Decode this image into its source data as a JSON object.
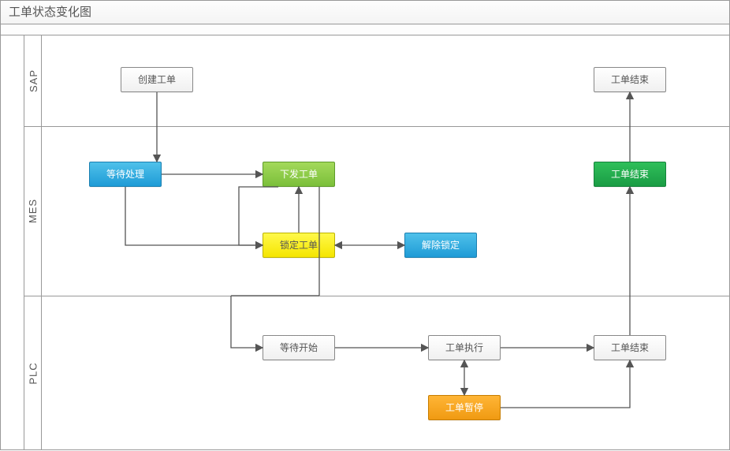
{
  "title": "工单状态变化图",
  "lanes": {
    "sap": "SAP",
    "mes": "MES",
    "plc": "PLC"
  },
  "nodes": {
    "create": "创建工单",
    "end_sap": "工单结束",
    "wait_process": "等待处理",
    "dispatch": "下发工单",
    "lock": "锁定工单",
    "unlock": "解除锁定",
    "end_mes": "工单结束",
    "wait_start": "等待开始",
    "executing": "工单执行",
    "pause": "工单暂停",
    "end_plc": "工单结束"
  },
  "chart_data": {
    "type": "other",
    "diagram_type": "swimlane-flowchart",
    "title": "工单状态变化图",
    "lanes": [
      "SAP",
      "MES",
      "PLC"
    ],
    "nodes": [
      {
        "id": "create",
        "lane": "SAP",
        "label": "创建工单",
        "color": "white"
      },
      {
        "id": "end_sap",
        "lane": "SAP",
        "label": "工单结束",
        "color": "white"
      },
      {
        "id": "wait_process",
        "lane": "MES",
        "label": "等待处理",
        "color": "blue"
      },
      {
        "id": "dispatch",
        "lane": "MES",
        "label": "下发工单",
        "color": "green"
      },
      {
        "id": "lock",
        "lane": "MES",
        "label": "锁定工单",
        "color": "yellow"
      },
      {
        "id": "unlock",
        "lane": "MES",
        "label": "解除锁定",
        "color": "blue"
      },
      {
        "id": "end_mes",
        "lane": "MES",
        "label": "工单结束",
        "color": "green-dark"
      },
      {
        "id": "wait_start",
        "lane": "PLC",
        "label": "等待开始",
        "color": "white"
      },
      {
        "id": "executing",
        "lane": "PLC",
        "label": "工单执行",
        "color": "white"
      },
      {
        "id": "pause",
        "lane": "PLC",
        "label": "工单暂停",
        "color": "orange"
      },
      {
        "id": "end_plc",
        "lane": "PLC",
        "label": "工单结束",
        "color": "white"
      }
    ],
    "edges": [
      {
        "from": "create",
        "to": "wait_process",
        "bidirectional": false
      },
      {
        "from": "wait_process",
        "to": "dispatch",
        "bidirectional": false
      },
      {
        "from": "wait_process",
        "to": "lock",
        "bidirectional": false
      },
      {
        "from": "dispatch",
        "to": "lock",
        "bidirectional": true
      },
      {
        "from": "lock",
        "to": "unlock",
        "bidirectional": true
      },
      {
        "from": "dispatch",
        "to": "wait_start",
        "bidirectional": false
      },
      {
        "from": "wait_start",
        "to": "executing",
        "bidirectional": false
      },
      {
        "from": "executing",
        "to": "pause",
        "bidirectional": true
      },
      {
        "from": "executing",
        "to": "end_plc",
        "bidirectional": false
      },
      {
        "from": "pause",
        "to": "end_plc",
        "bidirectional": false
      },
      {
        "from": "end_plc",
        "to": "end_mes",
        "bidirectional": false
      },
      {
        "from": "end_mes",
        "to": "end_sap",
        "bidirectional": false
      }
    ]
  }
}
